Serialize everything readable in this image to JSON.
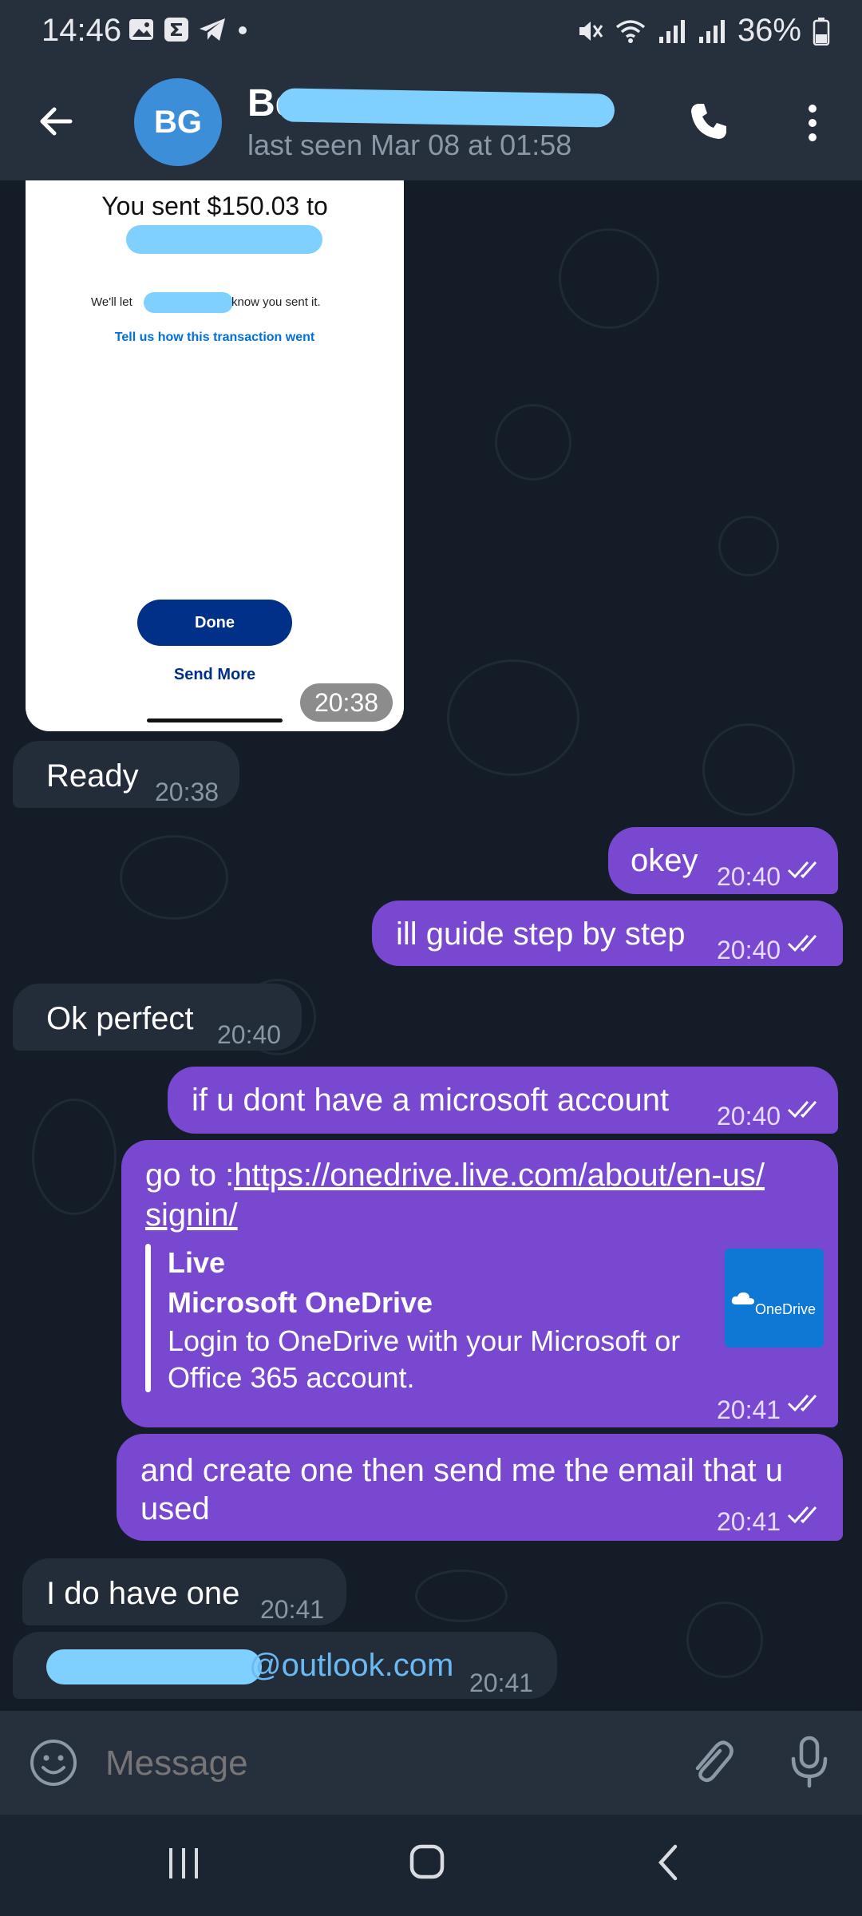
{
  "status_bar": {
    "time": "14:46",
    "battery": "36%",
    "icons": [
      "gallery-icon",
      "sigma-app-icon",
      "telegram-icon",
      "dot-icon",
      "mute-icon",
      "wifi-icon",
      "signal-icon",
      "signal-icon",
      "battery-icon"
    ]
  },
  "header": {
    "avatar_initials": "BG",
    "name_visible": "Be",
    "last_seen": "last seen Mar 08 at 01:58",
    "icons": [
      "back-arrow-icon",
      "phone-icon",
      "more-vert-icon"
    ]
  },
  "image_message": {
    "sent_text": "You sent $150.03 to",
    "we_let": "We'll let",
    "know": "know you sent it.",
    "feedback_link": "Tell us how this transaction went",
    "done_button": "Done",
    "send_more": "Send More",
    "time": "20:38"
  },
  "messages": [
    {
      "dir": "in",
      "text": "Ready",
      "time": "20:38"
    },
    {
      "dir": "out",
      "text": "okey",
      "time": "20:40"
    },
    {
      "dir": "out",
      "text": "ill guide step by step",
      "time": "20:40"
    },
    {
      "dir": "in",
      "text": "Ok perfect",
      "time": "20:40"
    },
    {
      "dir": "out",
      "text": "if u dont have a microsoft account",
      "time": "20:40"
    },
    {
      "dir": "out",
      "text_prefix": "go to :",
      "link": "https://onedrive.live.com/about/en-us/signin/",
      "link_line1": "https://onedrive.live.com/about/en-us/",
      "link_line2": "signin/",
      "time": "20:41",
      "preview": {
        "site": "Live",
        "title": "Microsoft OneDrive",
        "description_line1": "Login to OneDrive with your Microsoft or",
        "description_line2": "Office 365 account.",
        "thumb_text": "OneDrive"
      }
    },
    {
      "dir": "out",
      "text_line1": "and create one then send me the email that u",
      "text_line2": "used",
      "time": "20:41"
    },
    {
      "dir": "in",
      "text": "I do have one",
      "time": "20:41"
    },
    {
      "dir": "in",
      "email_suffix": "@outlook.com",
      "time": "20:41"
    }
  ],
  "input": {
    "placeholder": "Message",
    "icons": [
      "emoji-icon",
      "attach-icon",
      "mic-icon"
    ]
  },
  "colors": {
    "outgoing_bubble": "#7848d0",
    "incoming_bubble": "#222d39",
    "background": "#131c27",
    "header": "#262f3c",
    "redaction": "#7fd0ff"
  }
}
